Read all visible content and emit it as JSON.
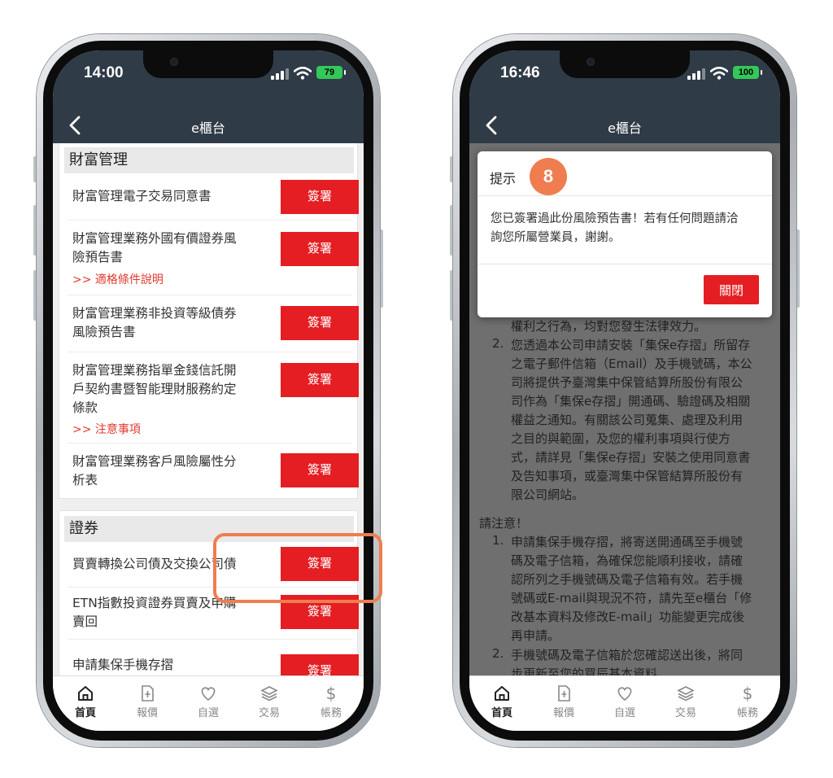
{
  "left_phone": {
    "status": {
      "time": "14:00",
      "battery": "79"
    },
    "nav": {
      "title": "e櫃台"
    },
    "wealth_section": {
      "title": "財富管理",
      "rows": [
        {
          "lines": [
            "財富管理電子交易同意書"
          ],
          "link": "",
          "button": "簽署"
        },
        {
          "lines": [
            "財富管理業務外國有價證券風",
            "險預告書"
          ],
          "link": ">> 適格條件說明",
          "button": "簽署"
        },
        {
          "lines": [
            "財富管理業務非投資等級債券",
            "風險預告書"
          ],
          "link": "",
          "button": "簽署"
        },
        {
          "lines": [
            "財富管理業務指單金錢信託開",
            "戶契約書暨智能理財服務約定",
            "條款"
          ],
          "link": ">> 注意事項",
          "button": "簽署"
        },
        {
          "lines": [
            "財富管理業務客戶風險屬性分",
            "析表"
          ],
          "link": "",
          "button": "簽署"
        }
      ]
    },
    "securities_section": {
      "title": "證券",
      "rows": [
        {
          "lines": [
            "買賣轉換公司債及交換公司債"
          ],
          "button": "簽署"
        },
        {
          "lines": [
            "ETN指數投資證券買賣及申購",
            "賣回"
          ],
          "button": "簽署"
        },
        {
          "lines": [
            "申請集保手機存摺"
          ],
          "button": "簽署"
        }
      ]
    }
  },
  "tabs": [
    {
      "label": "首頁",
      "icon": "home-icon"
    },
    {
      "label": "報價",
      "icon": "quote-icon"
    },
    {
      "label": "自選",
      "icon": "heart-icon"
    },
    {
      "label": "交易",
      "icon": "layers-icon"
    },
    {
      "label": "帳務",
      "icon": "dollar-icon"
    }
  ],
  "right_phone": {
    "status": {
      "time": "16:46",
      "battery": "100"
    },
    "nav": {
      "title": "e櫃台"
    },
    "dialog": {
      "title": "提示",
      "step_badge": "8",
      "message_lines": [
        "您已簽署過此份風險預告書！若有任何問題請洽",
        "詢您所屬營業員，謝謝。"
      ],
      "close_label": "關閉"
    },
    "document": {
      "lines_a": [
        "權利之行為，均對您發生法律效力。",
        "您透過本公司申請安裝「集保e存摺」所留存",
        "之電子郵件信箱（Email）及手機號碼，本公",
        "司將提供予臺灣集中保管結算所股份有限公",
        "司作為「集保e存摺」開通碼、驗證碼及相關",
        "權益之通知。有關該公司蒐集、處理及利用",
        "之目的與範圍，及您的權利事項與行使方",
        "式，請詳見「集保e存摺」安裝之使用同意書",
        "及告知事項，或臺灣集中保管結算所股份有",
        "限公司網站。"
      ],
      "num_a2": "2.",
      "notice_title": "請注意！",
      "num_b1": "1.",
      "lines_b": [
        "申請集保手機存摺，將寄送開通碼至手機號",
        "碼及電子信箱，為確保您能順利接收，請確",
        "認所列之手機號碼及電子信箱有效。若手機",
        "號碼或E-mail與現況不符，請先至e櫃台「修",
        "改基本資料及修改E-mail」功能變更完成後",
        "再申請。"
      ],
      "num_b2": "2.",
      "lines_c": [
        "手機號碼及電子信箱於您確認送出後，將同",
        "步更新至您的買辰基本資料。"
      ]
    }
  }
}
